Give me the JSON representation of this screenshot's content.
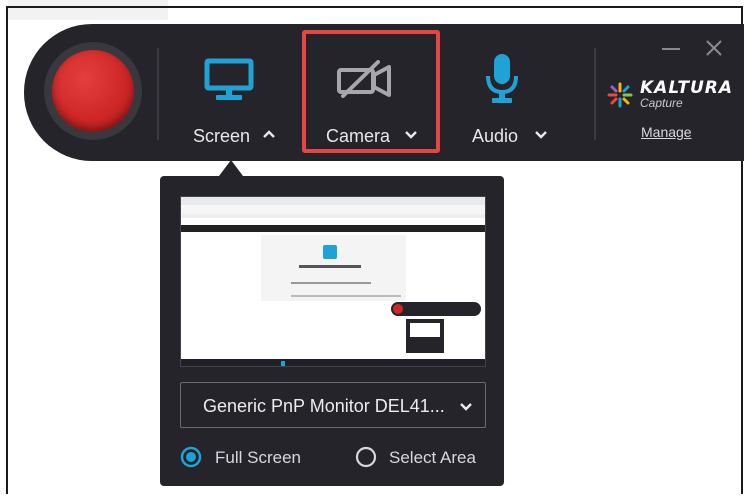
{
  "toolbar": {
    "screen": {
      "label": "Screen",
      "state": "expanded"
    },
    "camera": {
      "label": "Camera",
      "state": "off"
    },
    "audio": {
      "label": "Audio"
    }
  },
  "brand": {
    "name": "KALTURA",
    "product": "Capture",
    "manage_label": "Manage"
  },
  "panel": {
    "monitor_select": "Generic PnP Monitor DEL41...",
    "options": [
      {
        "label": "Full Screen",
        "selected": true
      },
      {
        "label": "Select Area",
        "selected": false
      }
    ]
  },
  "colors": {
    "toolbar_bg": "#25242a",
    "accent": "#1fa3d7",
    "record": "#cf2727",
    "highlight": "#e64545"
  }
}
